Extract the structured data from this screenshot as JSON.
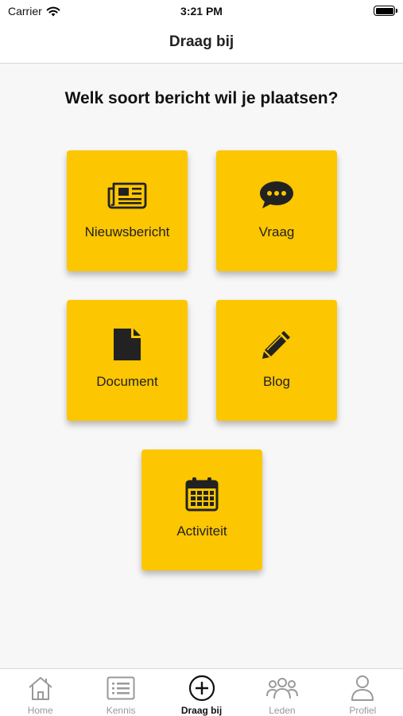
{
  "status_bar": {
    "carrier": "Carrier",
    "time": "3:21 PM"
  },
  "nav": {
    "title": "Draag bij"
  },
  "heading": "Welk soort bericht wil je plaatsen?",
  "tiles": [
    {
      "label": "Nieuwsbericht",
      "icon": "newspaper-icon"
    },
    {
      "label": "Vraag",
      "icon": "speech-bubble-icon"
    },
    {
      "label": "Document",
      "icon": "document-icon"
    },
    {
      "label": "Blog",
      "icon": "pencil-icon"
    },
    {
      "label": "Activiteit",
      "icon": "calendar-icon"
    }
  ],
  "tab_bar": {
    "items": [
      {
        "label": "Home",
        "icon": "home-icon",
        "active": false
      },
      {
        "label": "Kennis",
        "icon": "list-icon",
        "active": false
      },
      {
        "label": "Draag bij",
        "icon": "plus-circle-icon",
        "active": true
      },
      {
        "label": "Leden",
        "icon": "people-icon",
        "active": false
      },
      {
        "label": "Profiel",
        "icon": "person-icon",
        "active": false
      }
    ]
  },
  "colors": {
    "tile_background": "#fcc600",
    "page_background": "#f7f7f7",
    "active_tab": "#111111",
    "inactive_tab": "#999999"
  }
}
